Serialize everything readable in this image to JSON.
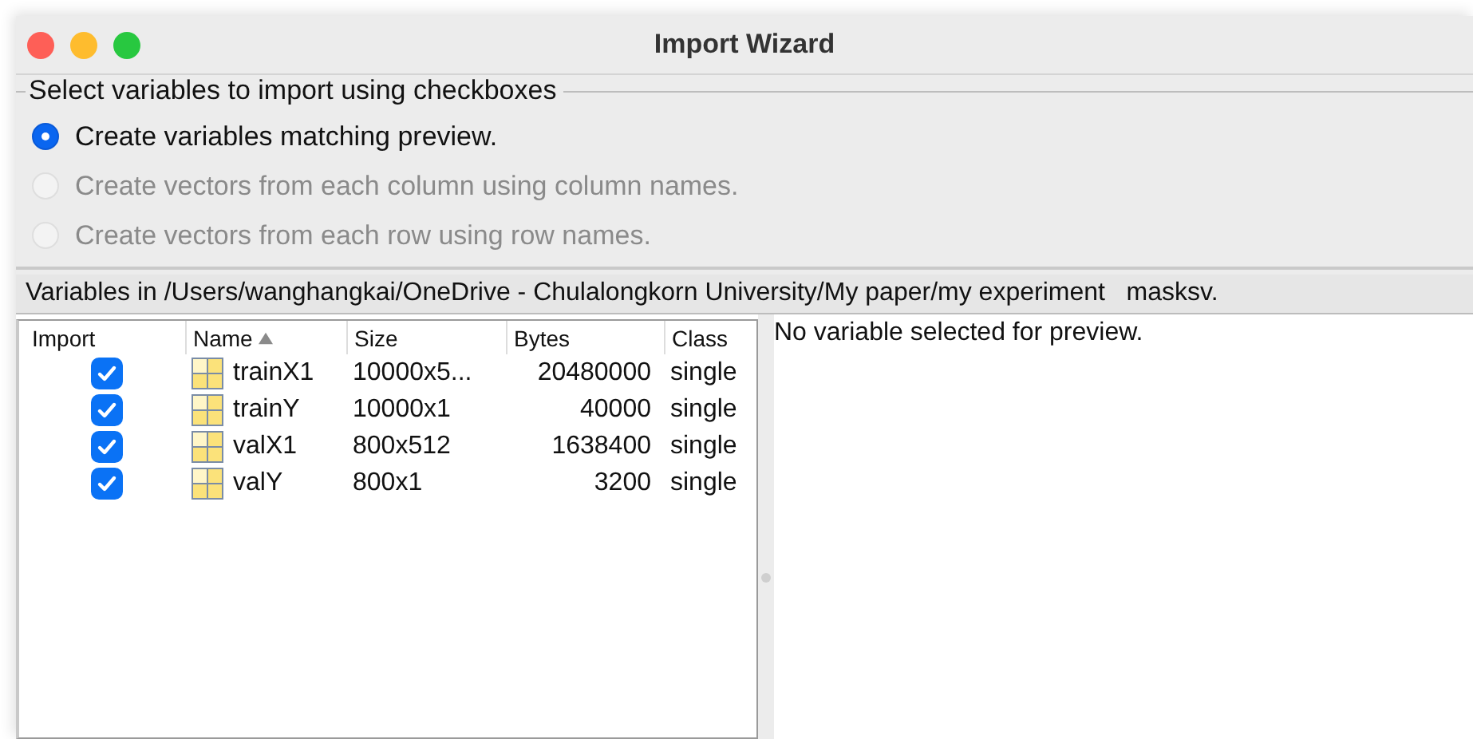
{
  "window": {
    "title": "Import Wizard"
  },
  "options": {
    "legend": "Select variables to import using checkboxes",
    "radios": [
      {
        "label": "Create variables matching preview.",
        "selected": true,
        "disabled": false
      },
      {
        "label": "Create vectors from each column using column names.",
        "selected": false,
        "disabled": true
      },
      {
        "label": "Create vectors from each row using row names.",
        "selected": false,
        "disabled": true
      }
    ]
  },
  "path_label": "Variables in /Users/wanghangkai/OneDrive - Chulalongkorn University/My paper/my experiment   masksv.",
  "table": {
    "columns": [
      {
        "label": "Import",
        "sorted": false
      },
      {
        "label": "Name",
        "sorted": true
      },
      {
        "label": "Size",
        "sorted": false
      },
      {
        "label": "Bytes",
        "sorted": false
      },
      {
        "label": "Class",
        "sorted": false
      }
    ],
    "rows": [
      {
        "checked": true,
        "name": "trainX1",
        "size": "10000x5...",
        "bytes": "20480000",
        "class": "single"
      },
      {
        "checked": true,
        "name": "trainY",
        "size": "10000x1",
        "bytes": "40000",
        "class": "single"
      },
      {
        "checked": true,
        "name": "valX1",
        "size": "800x512",
        "bytes": "1638400",
        "class": "single"
      },
      {
        "checked": true,
        "name": "valY",
        "size": "800x1",
        "bytes": "3200",
        "class": "single"
      }
    ]
  },
  "preview": {
    "message": "No variable selected for preview."
  }
}
